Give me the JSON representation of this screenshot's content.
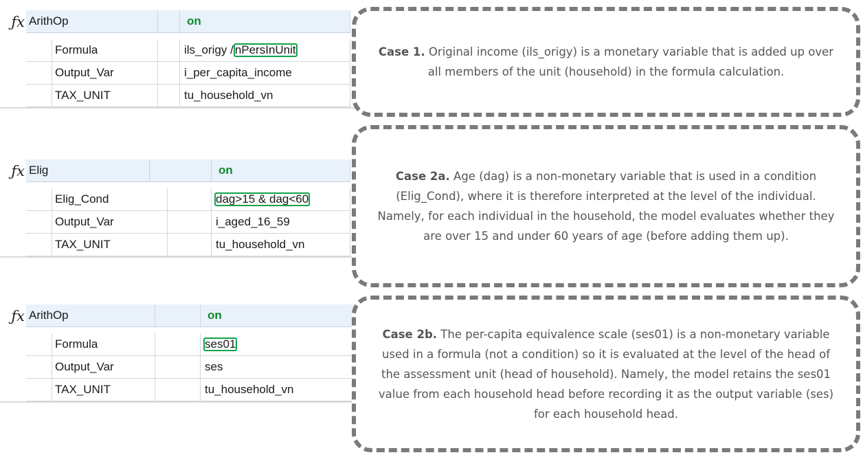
{
  "blocks": [
    {
      "function": "ArithOp",
      "status": "on",
      "rows": [
        {
          "param": "Formula",
          "value_prefix": "ils_origy /",
          "value_highlight": "nPersInUnit",
          "value_suffix": ""
        },
        {
          "param": "Output_Var",
          "value_prefix": "i_per_capita_income",
          "value_highlight": "",
          "value_suffix": ""
        },
        {
          "param": "TAX_UNIT",
          "value_prefix": "tu_household_vn",
          "value_highlight": "",
          "value_suffix": ""
        }
      ]
    },
    {
      "function": "Elig",
      "status": "on",
      "rows": [
        {
          "param": "Elig_Cond",
          "value_prefix": "",
          "value_highlight": "dag>15 & dag<60",
          "value_suffix": ""
        },
        {
          "param": "Output_Var",
          "value_prefix": "i_aged_16_59",
          "value_highlight": "",
          "value_suffix": ""
        },
        {
          "param": "TAX_UNIT",
          "value_prefix": "tu_household_vn",
          "value_highlight": "",
          "value_suffix": ""
        }
      ]
    },
    {
      "function": "ArithOp",
      "status": "on",
      "rows": [
        {
          "param": "Formula",
          "value_prefix": "",
          "value_highlight": "ses01",
          "value_suffix": ""
        },
        {
          "param": "Output_Var",
          "value_prefix": "ses",
          "value_highlight": "",
          "value_suffix": ""
        },
        {
          "param": "TAX_UNIT",
          "value_prefix": "tu_household_vn",
          "value_highlight": "",
          "value_suffix": ""
        }
      ]
    }
  ],
  "callouts": [
    {
      "heading": "Case 1.",
      "text": "Original income (ils_origy) is a monetary variable that is added up over all members of the unit (household) in the formula calculation."
    },
    {
      "heading": "Case 2a.",
      "text": "Age (dag) is a non-monetary variable that is used in a condition (Elig_Cond), where it is therefore interpreted at the level of the individual. Namely, for each individual in the household, the model evaluates whether they are over 15 and under 60 years of age (before adding them up)."
    },
    {
      "heading": "Case 2b.",
      "text": "The per-capita equivalence scale (ses01) is a non-monetary variable used in a formula (not a condition) so it is evaluated at the level of the head of the assessment unit (head of household). Namely, the model retains the ses01 value from each household head before recording it as the output variable (ses) for each household head."
    }
  ],
  "icons": {
    "function": "fx-icon"
  },
  "colors": {
    "on": "#0f8a2e",
    "highlight": "#12a24a",
    "header_bg": "#e9f1fb",
    "callout_border": "#7a7a7a"
  }
}
